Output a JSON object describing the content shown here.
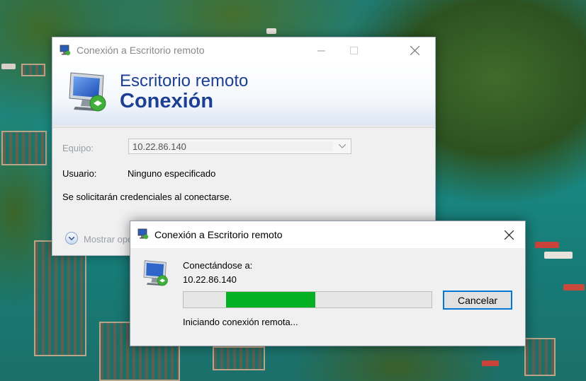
{
  "main_window": {
    "title": "Conexión a Escritorio remoto",
    "banner_line1": "Escritorio remoto",
    "banner_line2": "Conexión",
    "computer_label": "Equipo:",
    "computer_value": "10.22.86.140",
    "user_label": "Usuario:",
    "user_value": "Ninguno especificado",
    "credentials_note": "Se solicitarán credenciales al conectarse.",
    "show_options": "Mostrar opciones"
  },
  "connect_dialog": {
    "title": "Conexión a Escritorio remoto",
    "connecting_label": "Conectándose a:",
    "address": "10.22.86.140",
    "status": "Iniciando conexión remota...",
    "cancel_label": "Cancelar",
    "progress": {
      "start": 0.17,
      "end": 0.53
    }
  },
  "colors": {
    "banner_text": "#1c3f94",
    "progress_fill": "#06b025",
    "focus_border": "#0078d7"
  },
  "icons": [
    "remote-desktop-icon",
    "minimize-icon",
    "maximize-icon",
    "close-icon",
    "chevron-down-icon",
    "expand-options-icon"
  ]
}
